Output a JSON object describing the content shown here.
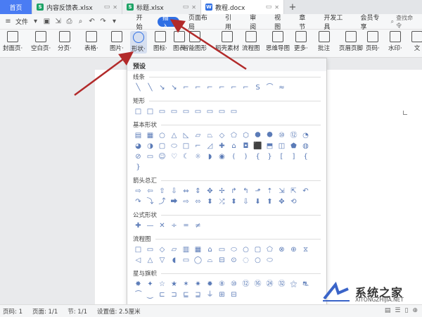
{
  "tabs": [
    {
      "label": "首页",
      "type": "home"
    },
    {
      "label": "内容反馈表.xlsx",
      "badge": "S",
      "badge_color": "#1ea366"
    },
    {
      "label": "标题.xlsx",
      "badge": "S",
      "badge_color": "#1ea366"
    },
    {
      "label": "教程.docx",
      "badge": "W",
      "badge_color": "#2f6fe4",
      "active": true
    }
  ],
  "tab_add": "+",
  "menubar": {
    "file_label": "文件",
    "items": [
      "开始",
      "插入",
      "页面布局",
      "引用",
      "审阅",
      "视图",
      "章节",
      "开发工具",
      "会员专享"
    ],
    "active_item": "插入",
    "search_label": "查找命令"
  },
  "ribbon": {
    "buttons": [
      {
        "label": "封面页·"
      },
      {
        "label": "空白页·"
      },
      {
        "label": "分页·"
      },
      {
        "label": "表格·"
      },
      {
        "label": "图片·"
      },
      {
        "label": "形状·",
        "selected": true
      },
      {
        "label": "图标·"
      },
      {
        "label": "图表"
      },
      {
        "label": "智能图形"
      },
      {
        "label": "稻壳素材"
      },
      {
        "label": "流程图"
      },
      {
        "label": "思维导图"
      },
      {
        "label": "更多·"
      },
      {
        "label": "批注"
      },
      {
        "label": "页眉页脚"
      },
      {
        "label": "页码·"
      },
      {
        "label": "水印·"
      },
      {
        "label": "文"
      }
    ]
  },
  "panel": {
    "title": "预设",
    "sections": [
      {
        "label": "线条",
        "shapes": [
          "╲",
          "╲",
          "↘",
          "↘",
          "⌐",
          "⌐",
          "⌐",
          "⌐",
          "⌐",
          "⌐",
          "S",
          "⌒",
          "≈"
        ]
      },
      {
        "label": "矩形",
        "shapes": [
          "□",
          "□",
          "▭",
          "▭",
          "▭",
          "▭",
          "▭",
          "▭",
          "▭"
        ]
      },
      {
        "label": "基本形状",
        "shapes": [
          "▤",
          "▦",
          "○",
          "△",
          "◺",
          "▱",
          "⏢",
          "◇",
          "⬠",
          "⬡",
          "⯃",
          "⯄",
          "⑩",
          "⑫",
          "◔",
          "◕",
          "◑",
          "▢",
          "⬭",
          "□",
          "⌐",
          "◿",
          "✚",
          "⌂",
          "◘",
          "⬛",
          "⬒",
          "◫",
          "⬟",
          "◍",
          "⊘",
          "▭",
          "☺",
          "♡",
          "☾",
          "☼",
          "◗",
          "◉",
          "(",
          ")",
          "{",
          "}",
          "[",
          "]",
          "{",
          "}"
        ]
      },
      {
        "label": "箭头总汇",
        "shapes": [
          "⇨",
          "⇦",
          "⇧",
          "⇩",
          "⇔",
          "⇕",
          "✥",
          "✢",
          "↱",
          "↰",
          "⬏",
          "⇡",
          "⇲",
          "⇱",
          "↶",
          "↷",
          "⤵",
          "⤴",
          "⮕",
          "⇨",
          "⬄",
          "⬍",
          "⤮",
          "⬍",
          "⇩",
          "⬇",
          "⬆",
          "✥",
          "⟲"
        ]
      },
      {
        "label": "公式形状",
        "shapes": [
          "✚",
          "—",
          "✕",
          "÷",
          "═",
          "≠"
        ]
      },
      {
        "label": "流程图",
        "shapes": [
          "□",
          "▭",
          "◇",
          "▱",
          "▥",
          "▦",
          "⌂",
          "▭",
          "⬭",
          "○",
          "▢",
          "⬠",
          "⊗",
          "⊕",
          "⧖",
          "◁",
          "△",
          "▽",
          "◖",
          "▭",
          "◯",
          "⌓",
          "⊟",
          "⊙",
          "◌",
          "○",
          "⬭"
        ]
      },
      {
        "label": "星与旗帜",
        "shapes": [
          "✸",
          "✦",
          "☆",
          "★",
          "✶",
          "✷",
          "✹",
          "⑧",
          "⑩",
          "⑫",
          "⑯",
          "㉔",
          "㉜",
          "⚝",
          "⛐",
          "⏜",
          "⏝",
          "⊏",
          "⊐",
          "⊑",
          "⊒",
          "⏚",
          "⊞",
          "⊟"
        ]
      }
    ]
  },
  "statusbar": {
    "items": [
      "页码: 1",
      "页面: 1/1",
      "节: 1/1",
      "设置值: 2.5厘米"
    ]
  },
  "watermark": {
    "text": "系统之家",
    "url": "XITONGZHIJIA.NET"
  },
  "colors": {
    "accent": "#2f6fe4",
    "home_tab": "#4a7cf3",
    "arrow": "#b22a2a",
    "shape_stroke": "#5b7bb7"
  }
}
